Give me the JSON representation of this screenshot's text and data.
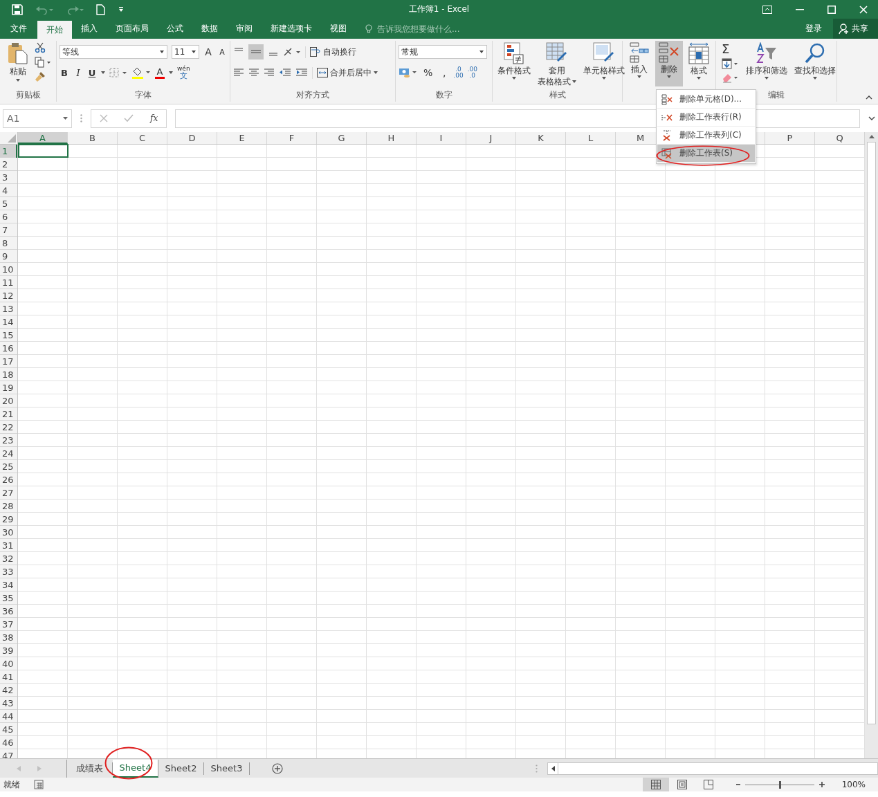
{
  "title_bar": {
    "title": "工作簿1 - Excel"
  },
  "menu_tabs": [
    {
      "label": "文件",
      "selected": false
    },
    {
      "label": "开始",
      "selected": true
    },
    {
      "label": "插入",
      "selected": false
    },
    {
      "label": "页面布局",
      "selected": false
    },
    {
      "label": "公式",
      "selected": false
    },
    {
      "label": "数据",
      "selected": false
    },
    {
      "label": "审阅",
      "selected": false
    },
    {
      "label": "新建选项卡",
      "selected": false
    },
    {
      "label": "视图",
      "selected": false
    }
  ],
  "tell_me": {
    "placeholder": "告诉我您想要做什么..."
  },
  "sign_in": "登录",
  "share": "共享",
  "ribbon": {
    "clipboard": {
      "paste": "粘贴",
      "label": "剪贴板"
    },
    "font": {
      "font_name": "等线",
      "font_size": "11",
      "bold": "B",
      "italic": "I",
      "underline": "U",
      "grow": "A",
      "shrink": "A",
      "font_color": "A",
      "phonetic_top": "wén",
      "phonetic_bottom": "文",
      "label": "字体"
    },
    "alignment": {
      "wrap_text": "自动换行",
      "merge_center": "合并后居中",
      "label": "对齐方式"
    },
    "number": {
      "format": "常规",
      "percent": "%",
      "comma": ",",
      "increase_decimal": {
        "top": ".0",
        "bottom": ".00"
      },
      "decrease_decimal": {
        "top": ".00",
        "bottom": ".0"
      },
      "label": "数字"
    },
    "styles": {
      "buttons": [
        {
          "kind": "conditional",
          "lines": [
            "条件格式"
          ]
        },
        {
          "kind": "table",
          "lines": [
            "套用",
            "表格格式"
          ]
        },
        {
          "kind": "cellstyle",
          "lines": [
            "单元格样式"
          ]
        }
      ],
      "label": "样式"
    },
    "cells": {
      "buttons": [
        {
          "kind": "insert",
          "label": "插入",
          "pressed": false
        },
        {
          "kind": "delete",
          "label": "删除",
          "pressed": true
        },
        {
          "kind": "format",
          "label": "格式",
          "pressed": false
        }
      ]
    },
    "editing": {
      "sum": "Σ",
      "buttons": [
        {
          "kind": "sort",
          "label": "排序和筛选"
        },
        {
          "kind": "find",
          "label": "查找和选择"
        }
      ],
      "label": "编辑"
    }
  },
  "formula_bar": {
    "name_box": "A1",
    "fx": "fx"
  },
  "columns": [
    {
      "label": "A",
      "selected": true
    },
    {
      "label": "B",
      "selected": false
    },
    {
      "label": "C",
      "selected": false
    },
    {
      "label": "D",
      "selected": false
    },
    {
      "label": "E",
      "selected": false
    },
    {
      "label": "F",
      "selected": false
    },
    {
      "label": "G",
      "selected": false
    },
    {
      "label": "H",
      "selected": false
    },
    {
      "label": "I",
      "selected": false
    },
    {
      "label": "J",
      "selected": false
    },
    {
      "label": "K",
      "selected": false
    },
    {
      "label": "L",
      "selected": false
    },
    {
      "label": "M",
      "selected": false
    },
    {},
    {},
    {
      "label": "P",
      "selected": false
    },
    {
      "label": "Q",
      "selected": false
    }
  ],
  "rows": [
    {
      "label": "1",
      "selected": true
    },
    {
      "label": "2",
      "selected": false
    },
    {
      "label": "3",
      "selected": false
    },
    {
      "label": "4",
      "selected": false
    },
    {
      "label": "5",
      "selected": false
    },
    {
      "label": "6",
      "selected": false
    },
    {
      "label": "7",
      "selected": false
    },
    {
      "label": "8",
      "selected": false
    },
    {
      "label": "9",
      "selected": false
    },
    {
      "label": "10",
      "selected": false
    },
    {
      "label": "11",
      "selected": false
    },
    {
      "label": "12",
      "selected": false
    },
    {
      "label": "13",
      "selected": false
    },
    {
      "label": "14",
      "selected": false
    },
    {
      "label": "15",
      "selected": false
    },
    {
      "label": "16",
      "selected": false
    },
    {
      "label": "17",
      "selected": false
    },
    {
      "label": "18",
      "selected": false
    },
    {
      "label": "19",
      "selected": false
    },
    {
      "label": "20",
      "selected": false
    },
    {
      "label": "21",
      "selected": false
    },
    {
      "label": "22",
      "selected": false
    },
    {
      "label": "23",
      "selected": false
    },
    {
      "label": "24",
      "selected": false
    },
    {
      "label": "25",
      "selected": false
    },
    {
      "label": "26",
      "selected": false
    },
    {
      "label": "27",
      "selected": false
    },
    {
      "label": "28",
      "selected": false
    },
    {
      "label": "29",
      "selected": false
    },
    {
      "label": "30",
      "selected": false
    },
    {
      "label": "31",
      "selected": false
    },
    {
      "label": "32",
      "selected": false
    },
    {
      "label": "33",
      "selected": false
    },
    {
      "label": "34",
      "selected": false
    },
    {
      "label": "35",
      "selected": false
    },
    {
      "label": "36",
      "selected": false
    },
    {
      "label": "37",
      "selected": false
    },
    {
      "label": "38",
      "selected": false
    },
    {
      "label": "39",
      "selected": false
    },
    {
      "label": "40",
      "selected": false
    },
    {
      "label": "41",
      "selected": false
    },
    {
      "label": "42",
      "selected": false
    },
    {
      "label": "43",
      "selected": false
    },
    {
      "label": "44",
      "selected": false
    },
    {
      "label": "45",
      "selected": false
    },
    {
      "label": "46",
      "selected": false
    },
    {
      "label": "47",
      "selected": false
    }
  ],
  "delete_menu": [
    {
      "kind": "cells",
      "label": "删除单元格(D)...",
      "selected": false,
      "circled": false
    },
    {
      "kind": "rows",
      "label": "删除工作表行(R)",
      "selected": false,
      "circled": false
    },
    {
      "kind": "columns",
      "label": "删除工作表列(C)",
      "selected": false,
      "circled": false
    },
    {
      "kind": "sheet",
      "label": "删除工作表(S)",
      "selected": true,
      "circled": true
    }
  ],
  "sheet_tabs": [
    {
      "label": "成绩表",
      "selected": false,
      "circled": false
    },
    {
      "label": "Sheet4",
      "selected": true,
      "circled": true
    },
    {
      "label": "Sheet2",
      "selected": false,
      "circled": false
    },
    {
      "label": "Sheet3",
      "selected": false,
      "circled": false
    }
  ],
  "status_bar": {
    "status": "就绪",
    "views": [
      {
        "kind": "normal",
        "selected": true
      },
      {
        "kind": "layout",
        "selected": false
      },
      {
        "kind": "pagebreak",
        "selected": false
      }
    ],
    "zoom": {
      "level": 0.5,
      "reading": "100%"
    }
  }
}
